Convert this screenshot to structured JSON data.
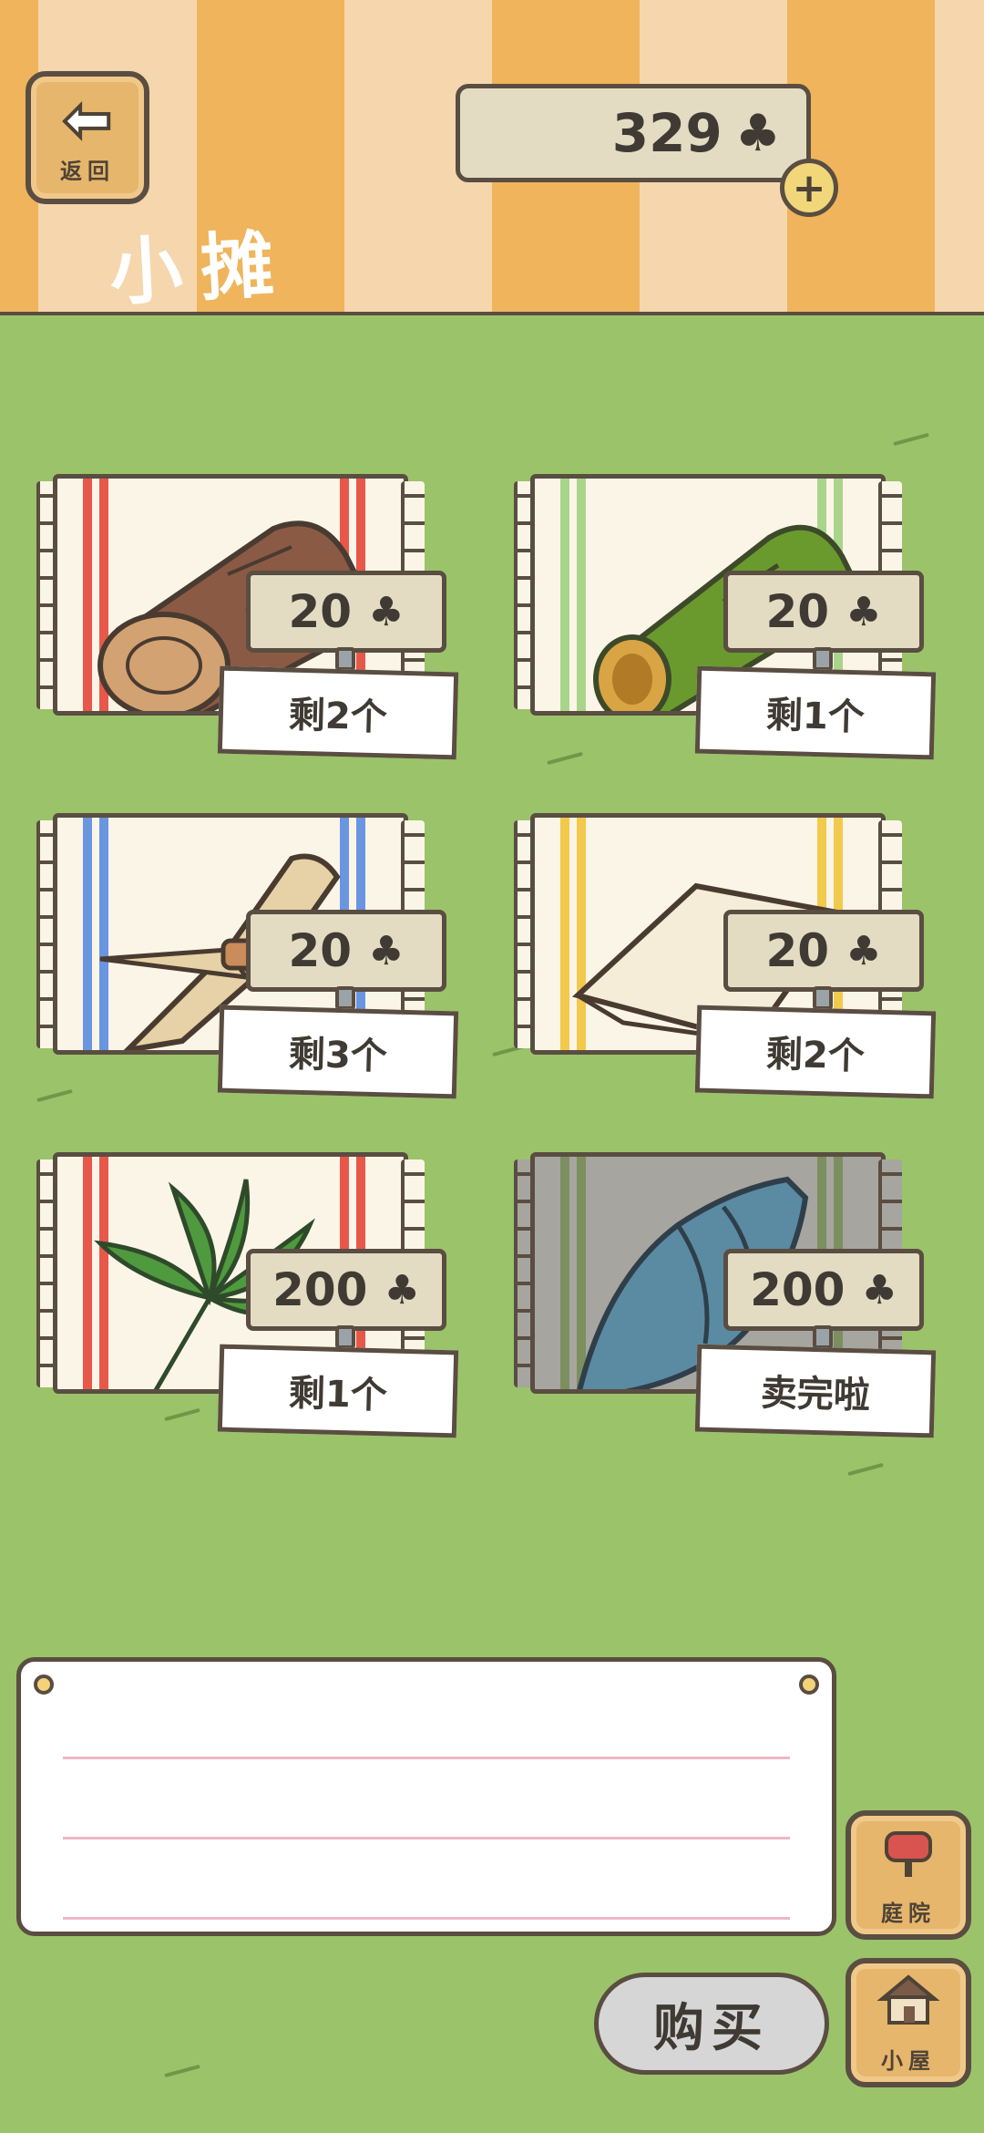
{
  "header": {
    "back_label": "返回",
    "title": "小摊",
    "clover_count": "329",
    "clover_symbol": "♣",
    "add_symbol": "+"
  },
  "items": [
    {
      "price": "20",
      "stock": "剩2个",
      "icon": "log-icon"
    },
    {
      "price": "20",
      "stock": "剩1个",
      "icon": "bamboo-icon"
    },
    {
      "price": "20",
      "stock": "剩3个",
      "icon": "straw-bundle-icon"
    },
    {
      "price": "20",
      "stock": "剩2个",
      "icon": "cloth-icon"
    },
    {
      "price": "200",
      "stock": "剩1个",
      "icon": "leaf-icon"
    },
    {
      "price": "200",
      "stock": "卖完啦",
      "icon": "shell-icon"
    }
  ],
  "buttons": {
    "buy": "购买",
    "yard": "庭院",
    "house": "小屋"
  },
  "colors": {
    "grass": "#9bc36a",
    "outline": "#5a4d41",
    "wood": "#e6b66c"
  }
}
